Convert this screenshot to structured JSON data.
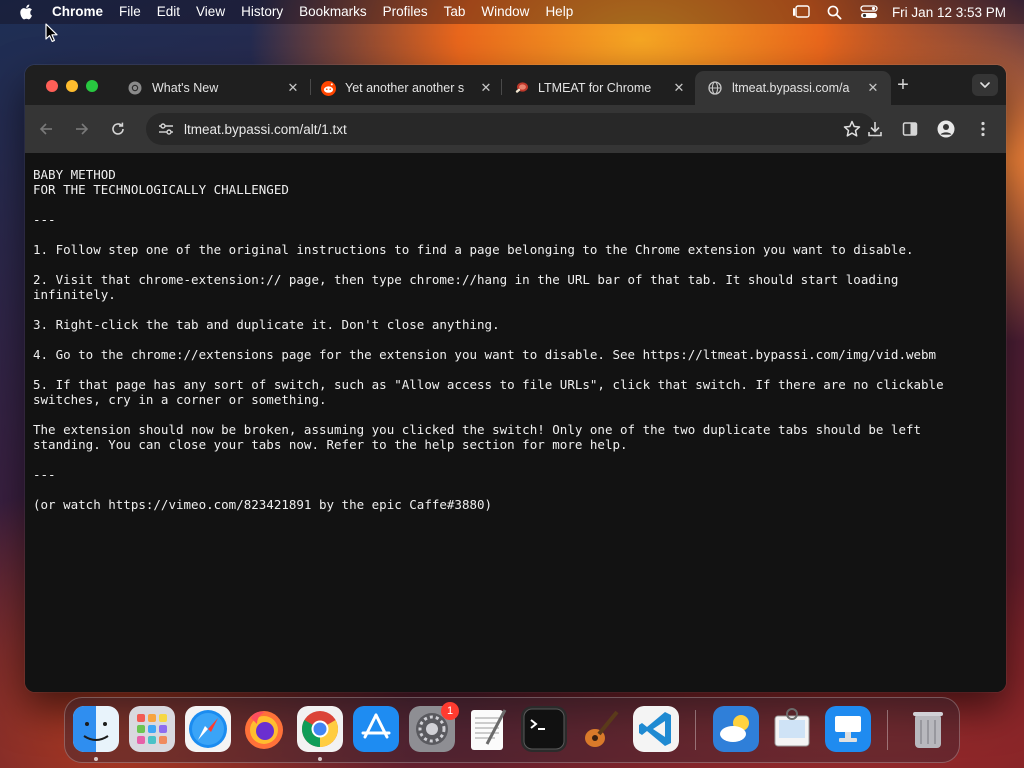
{
  "menubar": {
    "app_name": "Chrome",
    "items": [
      "File",
      "Edit",
      "View",
      "History",
      "Bookmarks",
      "Profiles",
      "Tab",
      "Window",
      "Help"
    ],
    "icons": [
      "stage-manager-icon",
      "spotlight-search-icon",
      "control-center-icon"
    ],
    "clock": "Fri Jan 12  3:53 PM"
  },
  "browser": {
    "tabs": [
      {
        "title": "What's New",
        "favicon": "chrome-logo-icon",
        "active": false
      },
      {
        "title": "Yet another another s",
        "favicon": "reddit-icon",
        "active": false
      },
      {
        "title": "LTMEAT for Chrome",
        "favicon": "meat-icon",
        "active": false
      },
      {
        "title": "ltmeat.bypassi.com/a",
        "favicon": "globe-icon",
        "active": true
      }
    ],
    "url": "ltmeat.bypassi.com/alt/1.txt",
    "colors": {
      "tabstrip": "#1f1f1f",
      "toolbar": "#353535",
      "page": "#121212"
    }
  },
  "page": {
    "text": "BABY METHOD\nFOR THE TECHNOLOGICALLY CHALLENGED\n\n---\n\n1. Follow step one of the original instructions to find a page belonging to the Chrome extension you want to disable.\n\n2. Visit that chrome-extension:// page, then type chrome://hang in the URL bar of that tab. It should start loading\ninfinitely.\n\n3. Right-click the tab and duplicate it. Don't close anything.\n\n4. Go to the chrome://extensions page for the extension you want to disable. See https://ltmeat.bypassi.com/img/vid.webm\n\n5. If that page has any sort of switch, such as \"Allow access to file URLs\", click that switch. If there are no clickable\nswitches, cry in a corner or something.\n\nThe extension should now be broken, assuming you clicked the switch! Only one of the two duplicate tabs should be left\nstanding. You can close your tabs now. Refer to the help section for more help.\n\n---\n\n(or watch https://vimeo.com/823421891 by the epic Caffe#3880)"
  },
  "dock": {
    "apps": [
      "Finder",
      "Launchpad",
      "Safari",
      "Firefox",
      "Google Chrome",
      "App Store",
      "System Settings",
      "TextEdit",
      "Terminal",
      "GarageBand",
      "Visual Studio Code",
      "Weather",
      "Preview",
      "Keynote",
      "Trash"
    ],
    "system_settings_badge": "1"
  }
}
